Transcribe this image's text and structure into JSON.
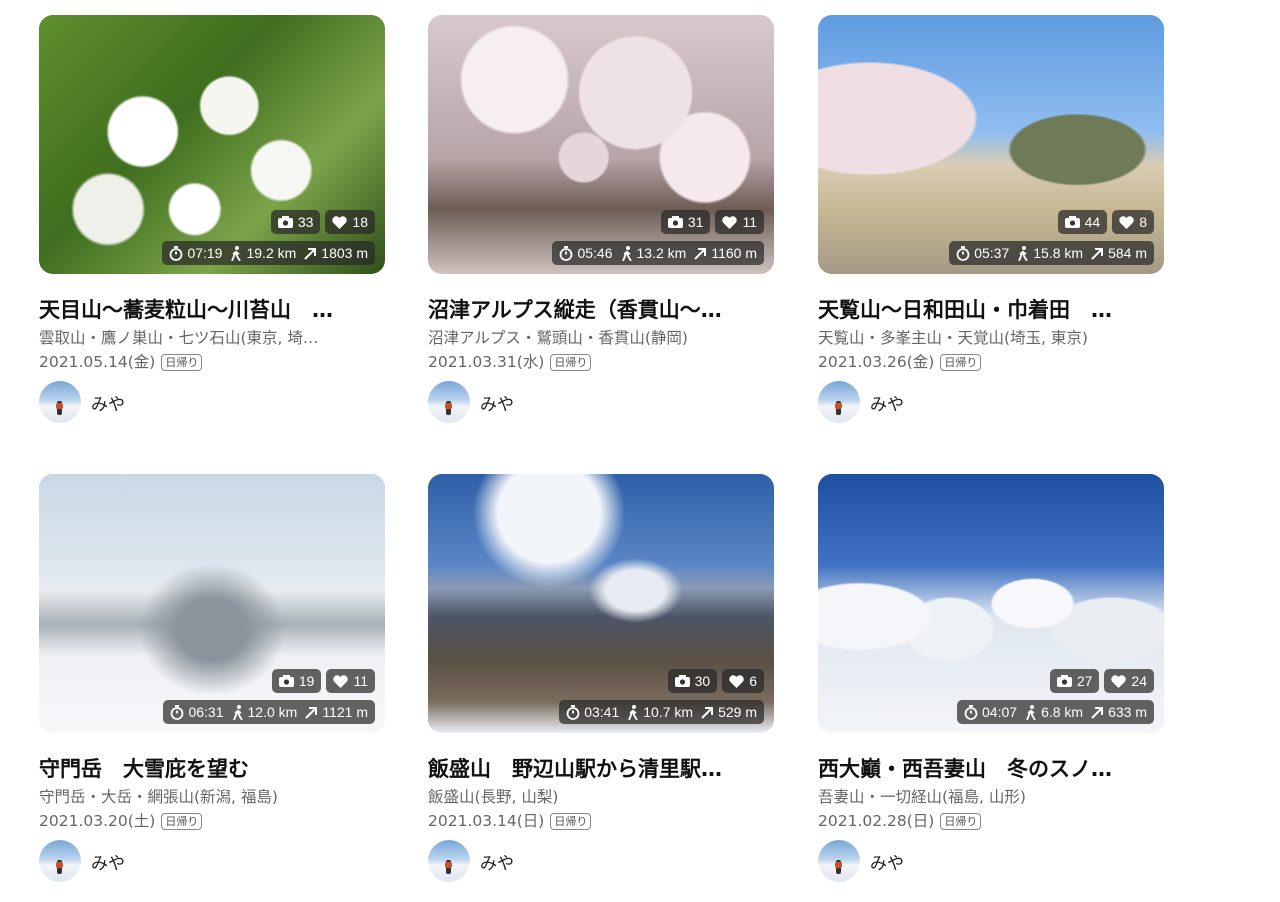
{
  "cards": [
    {
      "title": "天目山〜蕎麦粒山〜川苔山　…",
      "area": "雲取山・鷹ノ巣山・七ツ石山(東京, 埼…",
      "date": "2021.05.14(金)",
      "badge": "日帰り",
      "photos": "33",
      "likes": "18",
      "time": "07:19",
      "distance": "19.2 km",
      "ascent": "1803 m",
      "user": "みや",
      "icons": [
        "camera-icon",
        "heart-icon",
        "timer-icon",
        "walk-icon",
        "ascent-arrow-icon"
      ]
    },
    {
      "title": "沼津アルプス縦走（香貫山〜…",
      "area": "沼津アルプス・鷲頭山・香貫山(静岡)",
      "date": "2021.03.31(水)",
      "badge": "日帰り",
      "photos": "31",
      "likes": "11",
      "time": "05:46",
      "distance": "13.2 km",
      "ascent": "1160 m",
      "user": "みや"
    },
    {
      "title": "天覧山〜日和田山・巾着田　…",
      "area": "天覧山・多峯主山・天覚山(埼玉, 東京)",
      "date": "2021.03.26(金)",
      "badge": "日帰り",
      "photos": "44",
      "likes": "8",
      "time": "05:37",
      "distance": "15.8 km",
      "ascent": "584 m",
      "user": "みや"
    },
    {
      "title": "守門岳　大雪庇を望む",
      "area": "守門岳・大岳・網張山(新潟, 福島)",
      "date": "2021.03.20(土)",
      "badge": "日帰り",
      "photos": "19",
      "likes": "11",
      "time": "06:31",
      "distance": "12.0 km",
      "ascent": "1121 m",
      "user": "みや"
    },
    {
      "title": "飯盛山　野辺山駅から清里駅…",
      "area": "飯盛山(長野, 山梨)",
      "date": "2021.03.14(日)",
      "badge": "日帰り",
      "photos": "30",
      "likes": "6",
      "time": "03:41",
      "distance": "10.7 km",
      "ascent": "529 m",
      "user": "みや"
    },
    {
      "title": "西大巓・西吾妻山　冬のスノ…",
      "area": "吾妻山・一切経山(福島, 山形)",
      "date": "2021.02.28(日)",
      "badge": "日帰り",
      "photos": "27",
      "likes": "24",
      "time": "04:07",
      "distance": "6.8 km",
      "ascent": "633 m",
      "user": "みや"
    }
  ]
}
